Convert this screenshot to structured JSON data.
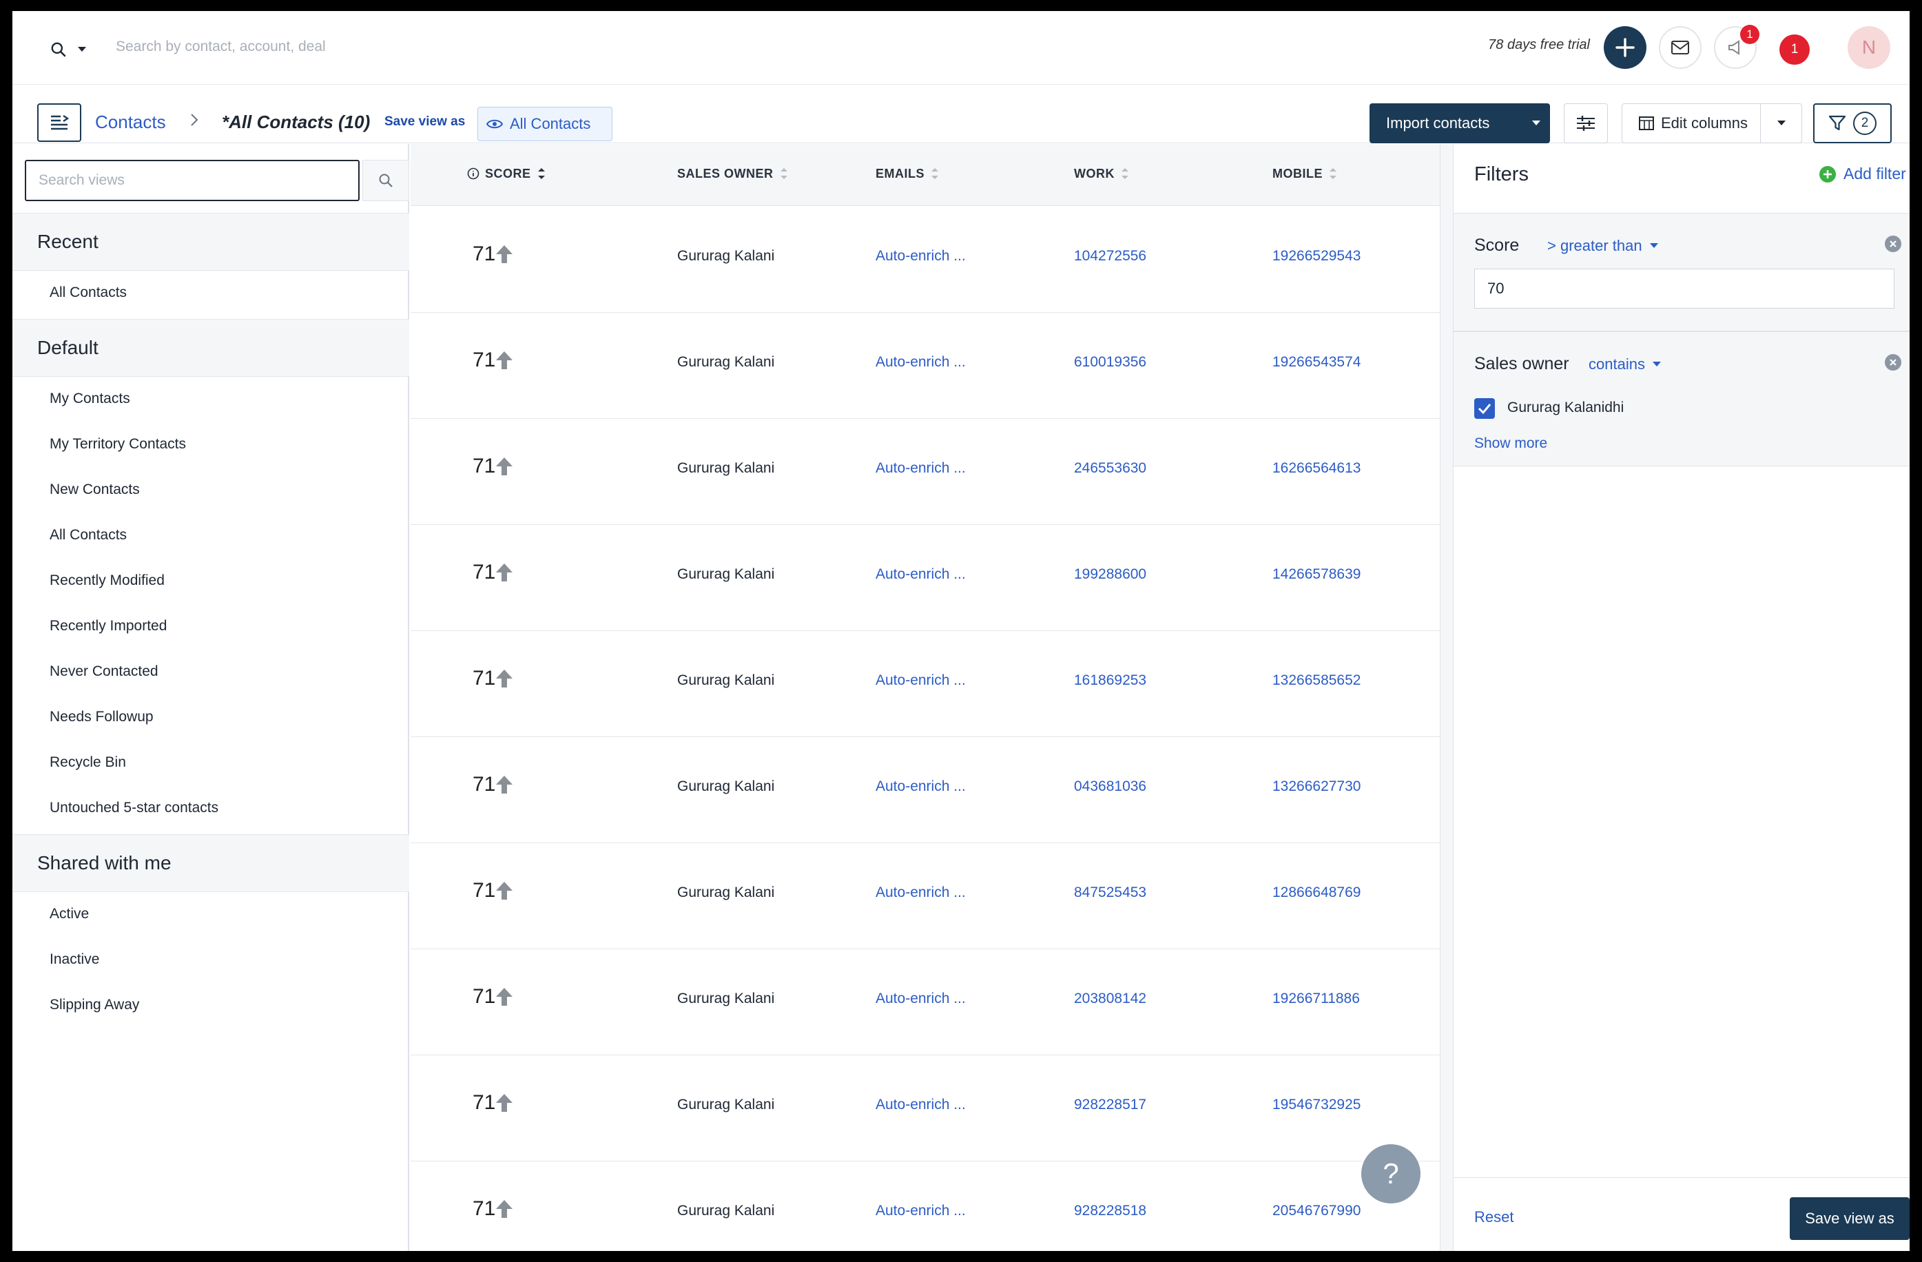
{
  "topbar": {
    "search_placeholder": "Search by contact, account, deal",
    "trial_text": "78 days free trial",
    "notification_count": "1",
    "alert_count": "1",
    "avatar_initial": "N"
  },
  "toolbar": {
    "breadcrumb_root": "Contacts",
    "breadcrumb_separator": ">",
    "current_view": "*All Contacts (10)",
    "save_view_as": "Save view as",
    "view_chip": "All Contacts",
    "import_label": "Import contacts",
    "edit_columns_label": "Edit columns",
    "filter_count": "2"
  },
  "views_panel": {
    "search_placeholder": "Search views",
    "sections": [
      {
        "title": "Recent",
        "items": [
          "All Contacts"
        ]
      },
      {
        "title": "Default",
        "items": [
          "My Contacts",
          "My Territory Contacts",
          "New Contacts",
          "All Contacts",
          "Recently Modified",
          "Recently Imported",
          "Never Contacted",
          "Needs Followup",
          "Recycle Bin",
          "Untouched 5-star contacts"
        ]
      },
      {
        "title": "Shared with me",
        "items": [
          "Active",
          "Inactive",
          "Slipping Away"
        ]
      }
    ]
  },
  "table": {
    "columns": [
      "SCORE",
      "SALES OWNER",
      "EMAILS",
      "WORK",
      "MOBILE"
    ],
    "rows": [
      {
        "score": "71",
        "owner": "Gururag Kalani",
        "email": "Auto-enrich ...",
        "work": "104272556",
        "mobile": "19266529543"
      },
      {
        "score": "71",
        "owner": "Gururag Kalani",
        "email": "Auto-enrich ...",
        "work": "610019356",
        "mobile": "19266543574"
      },
      {
        "score": "71",
        "owner": "Gururag Kalani",
        "email": "Auto-enrich ...",
        "work": "246553630",
        "mobile": "16266564613"
      },
      {
        "score": "71",
        "owner": "Gururag Kalani",
        "email": "Auto-enrich ...",
        "work": "199288600",
        "mobile": "14266578639"
      },
      {
        "score": "71",
        "owner": "Gururag Kalani",
        "email": "Auto-enrich ...",
        "work": "161869253",
        "mobile": "13266585652"
      },
      {
        "score": "71",
        "owner": "Gururag Kalani",
        "email": "Auto-enrich ...",
        "work": "043681036",
        "mobile": "13266627730"
      },
      {
        "score": "71",
        "owner": "Gururag Kalani",
        "email": "Auto-enrich ...",
        "work": "847525453",
        "mobile": "12866648769"
      },
      {
        "score": "71",
        "owner": "Gururag Kalani",
        "email": "Auto-enrich ...",
        "work": "203808142",
        "mobile": "19266711886"
      },
      {
        "score": "71",
        "owner": "Gururag Kalani",
        "email": "Auto-enrich ...",
        "work": "928228517",
        "mobile": "19546732925"
      },
      {
        "score": "71",
        "owner": "Gururag Kalani",
        "email": "Auto-enrich ...",
        "work": "928228518",
        "mobile": "20546767990"
      }
    ]
  },
  "help_label": "?",
  "filters": {
    "title": "Filters",
    "add_filter": "Add filter",
    "score": {
      "name": "Score",
      "operator": "> greater than",
      "value": "70"
    },
    "sales_owner": {
      "name": "Sales owner",
      "operator": "contains",
      "checked_option": "Gururag Kalanidhi",
      "show_more": "Show more"
    },
    "reset": "Reset",
    "save_view_as": "Save view as"
  },
  "colors": {
    "primary_dark": "#1b3a55",
    "link": "#2c5cc5",
    "alert": "#e3202e",
    "add_icon": "#3cb043"
  }
}
